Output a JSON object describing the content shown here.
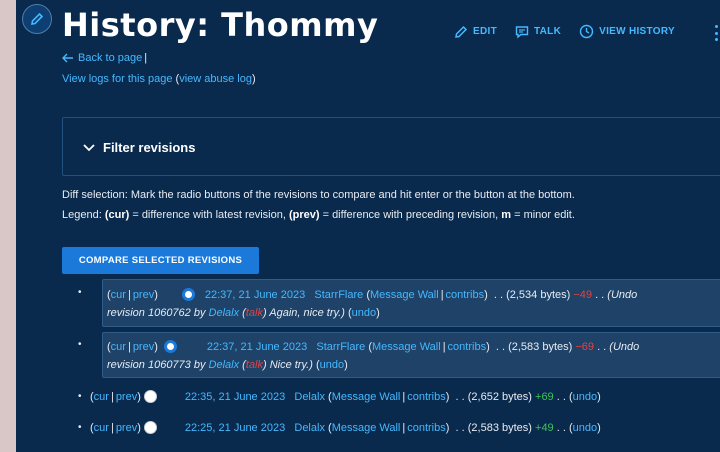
{
  "page": {
    "title": "History: Thommy",
    "actions": [
      {
        "label": "EDIT",
        "icon": "pencil-icon"
      },
      {
        "label": "TALK",
        "icon": "speech-bubble-icon"
      },
      {
        "label": "VIEW HISTORY",
        "icon": "clock-icon"
      }
    ],
    "back_link": "Back to page",
    "back_sep": "|",
    "logs_link": "View logs for this page",
    "abuse_link": "view abuse log"
  },
  "filter": {
    "title": "Filter revisions"
  },
  "help": {
    "line1": "Diff selection: Mark the radio buttons of the revisions to compare and hit enter or the button at the bottom.",
    "legend_prefix": "Legend: ",
    "cur_term": "(cur)",
    "cur_desc": " = difference with latest revision, ",
    "prev_term": "(prev)",
    "prev_desc": " = difference with preceding revision, ",
    "m_term": "m",
    "m_desc": " = minor edit."
  },
  "compare_button": "COMPARE SELECTED REVISIONS",
  "revisions": [
    {
      "cur": "cur",
      "prev": "prev",
      "date": "22:37, 21 June 2023",
      "user": "StarrFlare",
      "wall": "Message Wall",
      "contribs": "contribs",
      "size": "(2,534 bytes)",
      "diff": "−49",
      "summary_a": "(Undo",
      "summary_b": "revision 1060762 by",
      "summary_user": "Delalx",
      "summary_talk": "talk",
      "summary_c": ") Again, nice try.)",
      "undo": "undo"
    },
    {
      "cur": "cur",
      "prev": "prev",
      "date": "22:37, 21 June 2023",
      "user": "StarrFlare",
      "wall": "Message Wall",
      "contribs": "contribs",
      "size": "(2,583 bytes)",
      "diff": "−69",
      "summary_a": "(Undo",
      "summary_b": "revision 1060773 by",
      "summary_user": "Delalx",
      "summary_talk": "talk",
      "summary_c": ") Nice try.)",
      "undo": "undo"
    },
    {
      "cur": "cur",
      "prev": "prev",
      "date": "22:35, 21 June 2023",
      "user": "Delalx",
      "wall": "Message Wall",
      "contribs": "contribs",
      "size": "(2,652 bytes)",
      "diff": "+69",
      "undo": "undo"
    },
    {
      "cur": "cur",
      "prev": "prev",
      "date": "22:25, 21 June 2023",
      "user": "Delalx",
      "wall": "Message Wall",
      "contribs": "contribs",
      "size": "(2,583 bytes)",
      "diff": "+49",
      "undo": "undo"
    }
  ],
  "colors": {
    "background": "#0a2a4d",
    "link": "#45b8ff",
    "button": "#1b7ad9",
    "negative_diff": "#e04545",
    "positive_diff": "#3cc35a",
    "highlight_row": "#1e4268"
  }
}
